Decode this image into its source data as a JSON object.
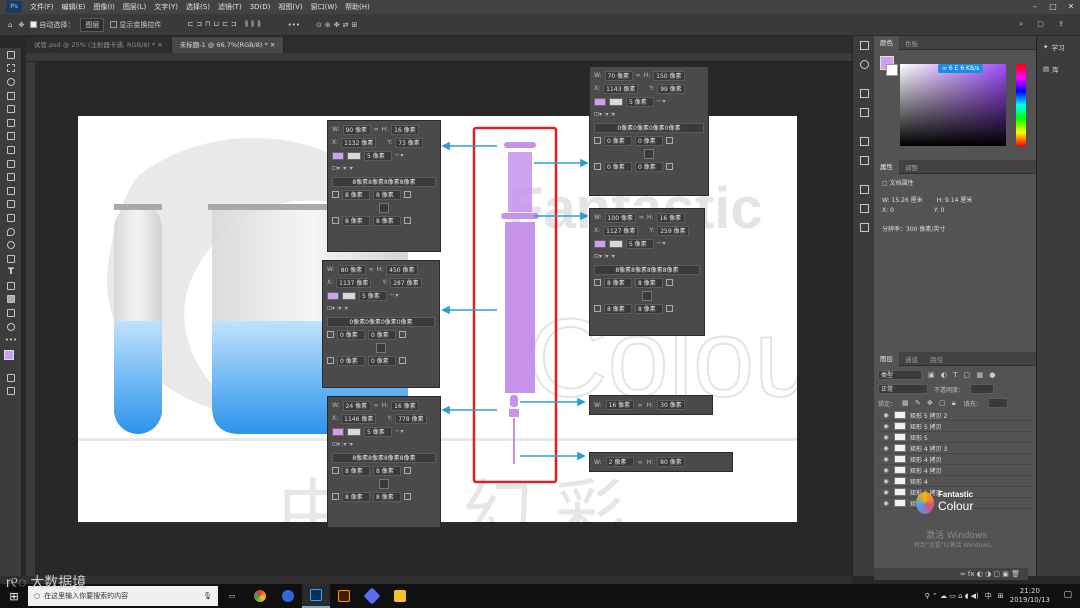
{
  "menubar": {
    "app_logo": "Ps",
    "items": [
      "文件(F)",
      "编辑(E)",
      "图像(I)",
      "图层(L)",
      "文字(Y)",
      "选择(S)",
      "滤镜(T)",
      "3D(D)",
      "视图(V)",
      "窗口(W)",
      "帮助(H)"
    ]
  },
  "options_bar": {
    "auto_select_label": "自动选择：",
    "auto_select_value": "图层",
    "show_transform_label": "显示变换控件",
    "more": "•••"
  },
  "tabs": [
    {
      "label": "试管.psd @ 25% (注射器卡通, RGB/8) *"
    },
    {
      "label": "未标题-1 @ 66.7%(RGB/8) *"
    }
  ],
  "colors": {
    "accent_purple": "#cfa0ef",
    "arrow_blue": "#2a9fd6",
    "highlight_red": "#e02020",
    "liquid_blue": "#3ca7f0"
  },
  "inspectors": {
    "p1": {
      "w": "90 像素",
      "h": "16 像素",
      "x": "1132 像素",
      "y": "73 像素",
      "stroke": "5 像素",
      "radii": "8像素8像素8像素8像素",
      "r1": "8 像素",
      "r2": "8 像素",
      "r3": "8 像素",
      "r4": "8 像素"
    },
    "p2": {
      "w": "80 像素",
      "h": "450 像素",
      "x": "1137 像素",
      "y": "287 像素",
      "stroke": "5 像素",
      "radii": "0像素0像素0像素0像素",
      "r1": "0 像素",
      "r2": "0 像素",
      "r3": "0 像素",
      "r4": "0 像素"
    },
    "p3": {
      "w": "24 像素",
      "h": "16 像素",
      "x": "1146 像素",
      "y": "778 像素",
      "stroke": "5 像素",
      "radii": "8像素8像素8像素8像素",
      "r1": "8 像素",
      "r2": "8 像素",
      "r3": "8 像素",
      "r4": "8 像素"
    },
    "p4": {
      "w": "70 像素",
      "h": "150 像素",
      "x": "1143 像素",
      "y": "99 像素",
      "stroke": "5 像素",
      "radii": "0像素0像素0像素0像素",
      "r1": "0 像素",
      "r2": "0 像素",
      "r3": "0 像素",
      "r4": "0 像素"
    },
    "p5": {
      "w": "100 像素",
      "h": "16 像素",
      "x": "1127 像素",
      "y": "259 像素",
      "stroke": "5 像素",
      "radii": "8像素8像素8像素8像素",
      "r1": "8 像素",
      "r2": "8 像素",
      "r3": "8 像素",
      "r4": "8 像素"
    }
  },
  "size_boxes": {
    "b1": {
      "w": "16 像素",
      "h": "30 像素"
    },
    "b2": {
      "w": "2 像素",
      "h": "80 像素"
    }
  },
  "labels": {
    "w": "W:",
    "h": "H:",
    "x": "X:",
    "y": "Y:"
  },
  "color_panel": {
    "tab1": "颜色",
    "tab2": "色板",
    "hex_badge": "6 E 6 KB/s"
  },
  "properties_panel": {
    "tab1": "属性",
    "tab2": "调整",
    "doc_props": "文档属性",
    "w": "W:  15.26 厘米",
    "h": "H:  9.14 厘米",
    "x": "X:  0",
    "y": "Y:  0",
    "resolution": "分辨率：300 像素/英寸"
  },
  "layers_panel": {
    "tab1": "图层",
    "tab2": "通道",
    "tab3": "路径",
    "filter": "类型",
    "blend": "正常",
    "opacity_label": "不透明度：",
    "lock_label": "锁定：",
    "fill_label": "填充：",
    "layers": [
      "矩形 5 拷贝 2",
      "矩形 5 拷贝",
      "矩形 5",
      "矩形 4 拷贝 3",
      "矩形 4 拷贝",
      "矩形 4 拷贝",
      "矩形 4",
      "矩形 1 拷贝",
      "矩形 1"
    ],
    "activate_text": "激活 Windows",
    "activate_sub": "转到\"设置\"以激活 Windows。"
  },
  "far_right": {
    "learn": "学习",
    "libs": "库"
  },
  "watermark": {
    "fantastic": "Fantastic",
    "colour": "Colour",
    "cn": "中 科 幻 彩",
    "corner_logo_text": "大数据境"
  },
  "taskbar": {
    "search_placeholder": "在这里输入你要搜索的内容",
    "time": "21:20",
    "date": "2019/10/13",
    "ime": "中"
  }
}
